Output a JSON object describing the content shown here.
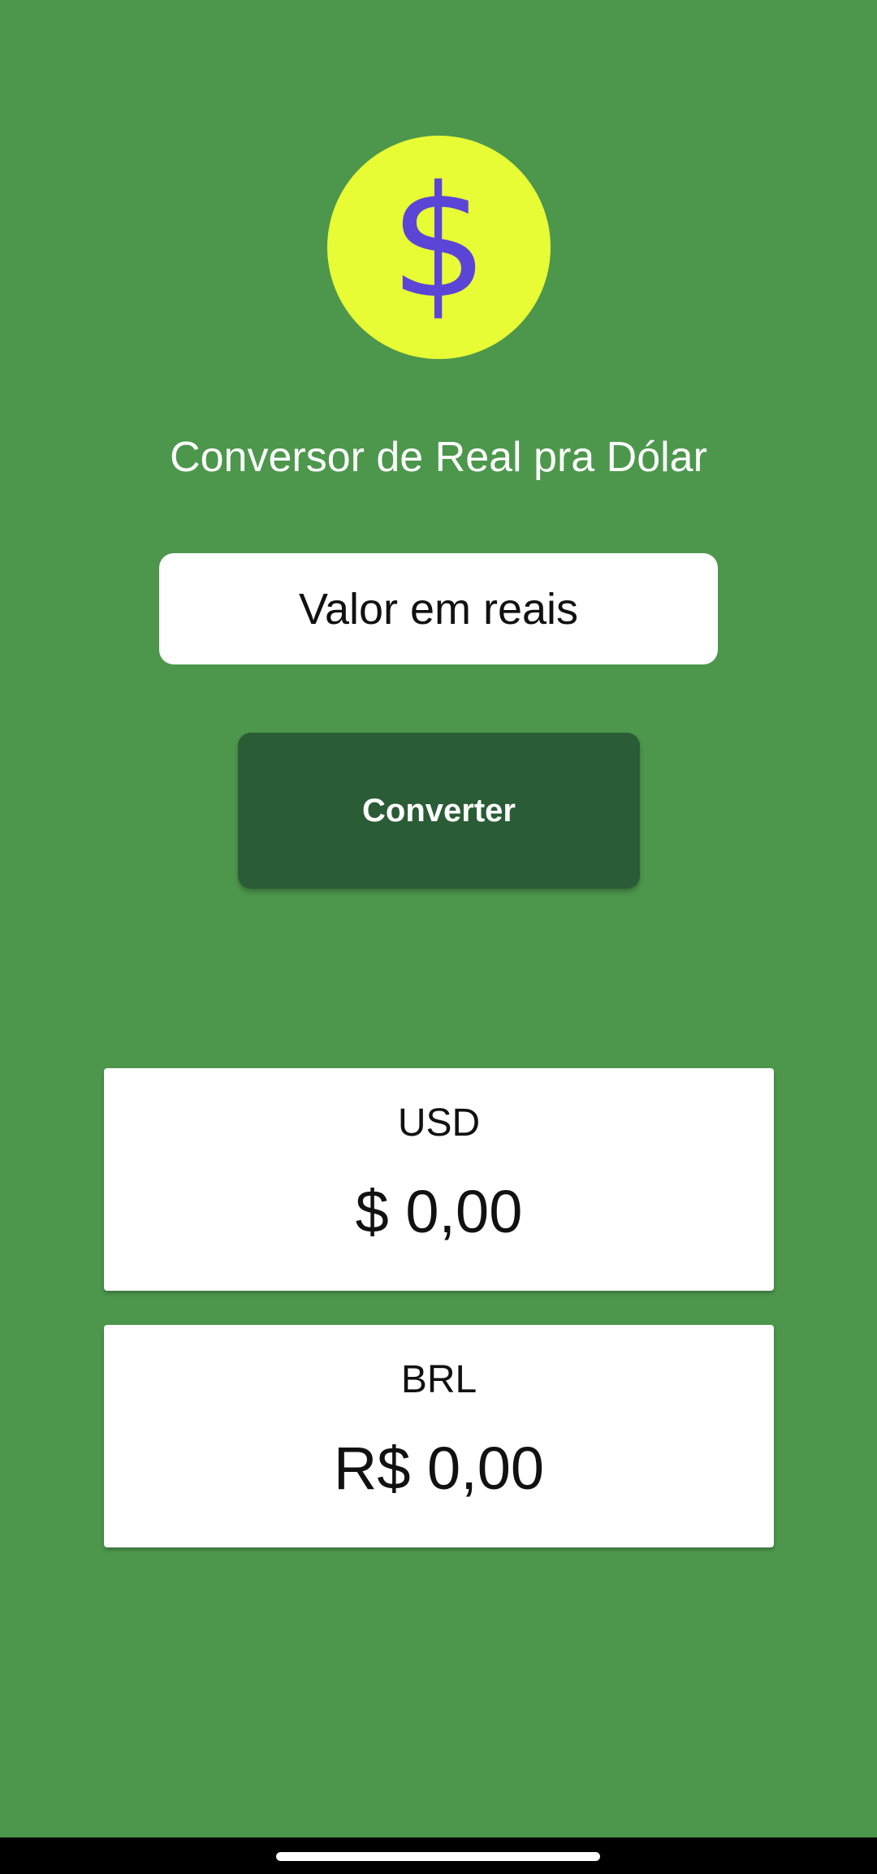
{
  "app": {
    "logo_symbol": "$",
    "title": "Conversor de Real pra Dólar"
  },
  "input": {
    "placeholder": "Valor em reais",
    "value": ""
  },
  "actions": {
    "convert_label": "Converter"
  },
  "results": [
    {
      "currency": "USD",
      "amount": "$ 0,00"
    },
    {
      "currency": "BRL",
      "amount": "R$ 0,00"
    }
  ],
  "colors": {
    "background": "#4c974c",
    "logo_circle": "#e8fc35",
    "logo_symbol": "#5b45d6",
    "button": "#2a5c36",
    "card": "#ffffff"
  },
  "icons": {
    "logo": "dollar-sign-icon"
  }
}
